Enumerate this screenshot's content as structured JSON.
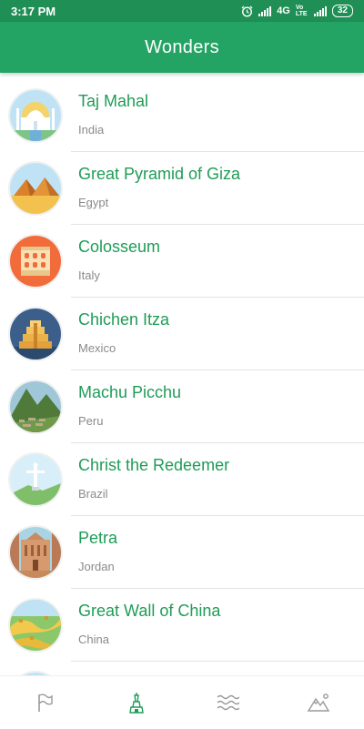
{
  "status_bar": {
    "time": "3:17 PM",
    "network": "4G",
    "volte": "Vo LTE",
    "battery": "32"
  },
  "app_bar": {
    "title": "Wonders"
  },
  "wonders": [
    {
      "name": "Taj Mahal",
      "country": "India",
      "icon": "taj-mahal-image"
    },
    {
      "name": "Great Pyramid of Giza",
      "country": "Egypt",
      "icon": "pyramid-image"
    },
    {
      "name": "Colosseum",
      "country": "Italy",
      "icon": "colosseum-image"
    },
    {
      "name": "Chichen Itza",
      "country": "Mexico",
      "icon": "chichen-itza-image"
    },
    {
      "name": "Machu Picchu",
      "country": "Peru",
      "icon": "machu-picchu-image"
    },
    {
      "name": "Christ the Redeemer",
      "country": "Brazil",
      "icon": "christ-redeemer-image"
    },
    {
      "name": "Petra",
      "country": "Jordan",
      "icon": "petra-image"
    },
    {
      "name": "Great Wall of China",
      "country": "China",
      "icon": "great-wall-image"
    }
  ],
  "bottom_nav": {
    "items": [
      "flag-icon",
      "tower-icon",
      "waves-icon",
      "mountains-icon"
    ],
    "active_index": 1
  },
  "colors": {
    "status_bar": "#1f8f55",
    "app_bar": "#24a464",
    "title_text": "#1f9c57",
    "subtitle_text": "#8a8a8a",
    "nav_active": "#1f9c57",
    "nav_inactive": "#9a9a9a"
  }
}
